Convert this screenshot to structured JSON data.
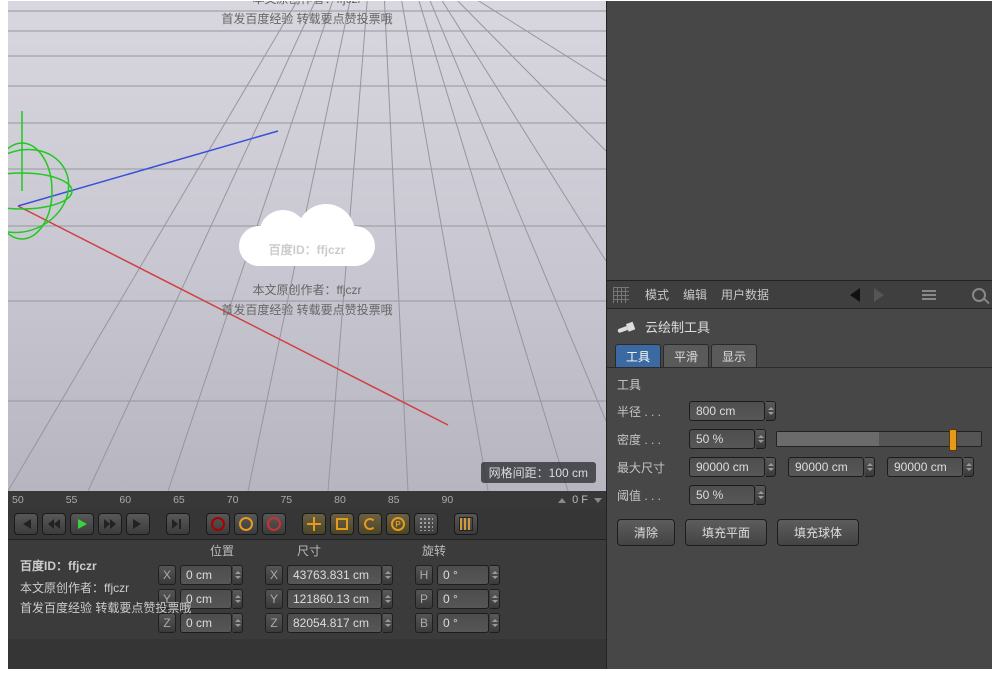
{
  "watermark": {
    "id_label": "百度ID：",
    "id_value": "ffjczr",
    "line1": "本文原创作者：ffjczr",
    "line2": "首发百度经验 转载要点赞投票哦"
  },
  "viewport": {
    "grid_info": "网格间距：100 cm"
  },
  "ruler": {
    "ticks": [
      "50",
      "55",
      "60",
      "65",
      "70",
      "75",
      "80",
      "85",
      "90"
    ],
    "temp": "0 F"
  },
  "coord": {
    "headers": {
      "position": "位置",
      "size": "尺寸",
      "rotation": "旋转"
    },
    "rows": [
      {
        "axis": "X",
        "pos": "0 cm",
        "size": "43763.831 cm",
        "rot_axis": "H",
        "rot": "0 °"
      },
      {
        "axis": "Y",
        "pos": "0 cm",
        "size": "121860.13 cm",
        "rot_axis": "P",
        "rot": "0 °"
      },
      {
        "axis": "Z",
        "pos": "0 cm",
        "size": "82054.817 cm",
        "rot_axis": "B",
        "rot": "0 °"
      }
    ]
  },
  "attr_menu": {
    "mode": "模式",
    "edit": "编辑",
    "user_data": "用户数据"
  },
  "tool_title": "云绘制工具",
  "tabs": {
    "tool": "工具",
    "smooth": "平滑",
    "display": "显示"
  },
  "section": "工具",
  "props": {
    "radius_label": "半径 . . .",
    "radius_value": "800 cm",
    "density_label": "密度 . . .",
    "density_value": "50 %",
    "max_label": "最大尺寸",
    "max_x": "90000 cm",
    "max_y": "90000 cm",
    "max_z": "90000 cm",
    "threshold_label": "阈值 . . .",
    "threshold_value": "50 %"
  },
  "buttons": {
    "clear": "清除",
    "fill_plane": "填充平面",
    "fill_sphere": "填充球体"
  }
}
